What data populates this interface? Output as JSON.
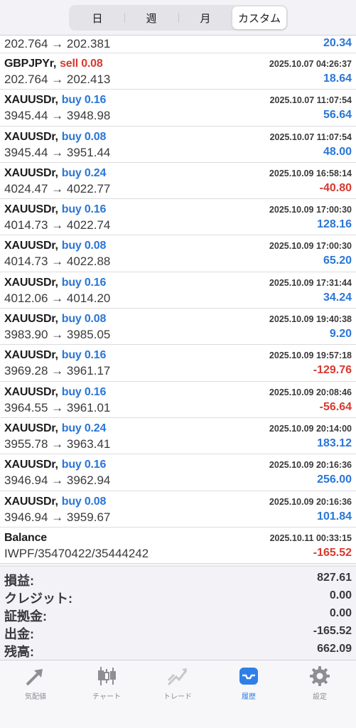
{
  "period_tabs": [
    "日",
    "週",
    "月",
    "カスタム"
  ],
  "period_active_index": 3,
  "trades": [
    {
      "symbol": "",
      "side": "",
      "side_type": "",
      "time": "",
      "prices": "202.764 → 202.381",
      "profit": "20.34",
      "profit_sign": "pos",
      "partial": true
    },
    {
      "symbol": "GBPJPYr,",
      "side": "sell 0.08",
      "side_type": "sell",
      "time": "2025.10.07 04:26:37",
      "prices": "202.764 → 202.413",
      "profit": "18.64",
      "profit_sign": "pos"
    },
    {
      "symbol": "XAUUSDr,",
      "side": "buy 0.16",
      "side_type": "buy",
      "time": "2025.10.07 11:07:54",
      "prices": "3945.44 → 3948.98",
      "profit": "56.64",
      "profit_sign": "pos"
    },
    {
      "symbol": "XAUUSDr,",
      "side": "buy 0.08",
      "side_type": "buy",
      "time": "2025.10.07 11:07:54",
      "prices": "3945.44 → 3951.44",
      "profit": "48.00",
      "profit_sign": "pos"
    },
    {
      "symbol": "XAUUSDr,",
      "side": "buy 0.24",
      "side_type": "buy",
      "time": "2025.10.09 16:58:14",
      "prices": "4024.47 → 4022.77",
      "profit": "-40.80",
      "profit_sign": "neg"
    },
    {
      "symbol": "XAUUSDr,",
      "side": "buy 0.16",
      "side_type": "buy",
      "time": "2025.10.09 17:00:30",
      "prices": "4014.73 → 4022.74",
      "profit": "128.16",
      "profit_sign": "pos"
    },
    {
      "symbol": "XAUUSDr,",
      "side": "buy 0.08",
      "side_type": "buy",
      "time": "2025.10.09 17:00:30",
      "prices": "4014.73 → 4022.88",
      "profit": "65.20",
      "profit_sign": "pos"
    },
    {
      "symbol": "XAUUSDr,",
      "side": "buy 0.16",
      "side_type": "buy",
      "time": "2025.10.09 17:31:44",
      "prices": "4012.06 → 4014.20",
      "profit": "34.24",
      "profit_sign": "pos"
    },
    {
      "symbol": "XAUUSDr,",
      "side": "buy 0.08",
      "side_type": "buy",
      "time": "2025.10.09 19:40:38",
      "prices": "3983.90 → 3985.05",
      "profit": "9.20",
      "profit_sign": "pos"
    },
    {
      "symbol": "XAUUSDr,",
      "side": "buy 0.16",
      "side_type": "buy",
      "time": "2025.10.09 19:57:18",
      "prices": "3969.28 → 3961.17",
      "profit": "-129.76",
      "profit_sign": "neg"
    },
    {
      "symbol": "XAUUSDr,",
      "side": "buy 0.16",
      "side_type": "buy",
      "time": "2025.10.09 20:08:46",
      "prices": "3964.55 → 3961.01",
      "profit": "-56.64",
      "profit_sign": "neg"
    },
    {
      "symbol": "XAUUSDr,",
      "side": "buy 0.24",
      "side_type": "buy",
      "time": "2025.10.09 20:14:00",
      "prices": "3955.78 → 3963.41",
      "profit": "183.12",
      "profit_sign": "pos"
    },
    {
      "symbol": "XAUUSDr,",
      "side": "buy 0.16",
      "side_type": "buy",
      "time": "2025.10.09 20:16:36",
      "prices": "3946.94 → 3962.94",
      "profit": "256.00",
      "profit_sign": "pos"
    },
    {
      "symbol": "XAUUSDr,",
      "side": "buy 0.08",
      "side_type": "buy",
      "time": "2025.10.09 20:16:36",
      "prices": "3946.94 → 3959.67",
      "profit": "101.84",
      "profit_sign": "pos"
    },
    {
      "symbol": "Balance",
      "side": "",
      "side_type": "",
      "time": "2025.10.11 00:33:15",
      "prices": "IWPF/35470422/35444242",
      "profit": "-165.52",
      "profit_sign": "neg"
    }
  ],
  "summary": [
    {
      "label": "損益:",
      "value": "827.61"
    },
    {
      "label": "クレジット:",
      "value": "0.00"
    },
    {
      "label": "証拠金:",
      "value": "0.00"
    },
    {
      "label": "出金:",
      "value": "-165.52"
    },
    {
      "label": "残高:",
      "value": "662.09"
    }
  ],
  "tabbar": [
    {
      "label": "気配値",
      "icon": "quotes-arrows-icon"
    },
    {
      "label": "チャート",
      "icon": "candlestick-chart-icon"
    },
    {
      "label": "トレード",
      "icon": "trade-line-icon"
    },
    {
      "label": "履歴",
      "icon": "history-tray-icon"
    },
    {
      "label": "設定",
      "icon": "settings-gear-icon"
    }
  ],
  "tabbar_active_index": 3,
  "colors": {
    "buy": "#2a76d6",
    "sell": "#d63a2f",
    "active_tab": "#2f7fe6",
    "inactive_icon": "#8e8e93"
  }
}
